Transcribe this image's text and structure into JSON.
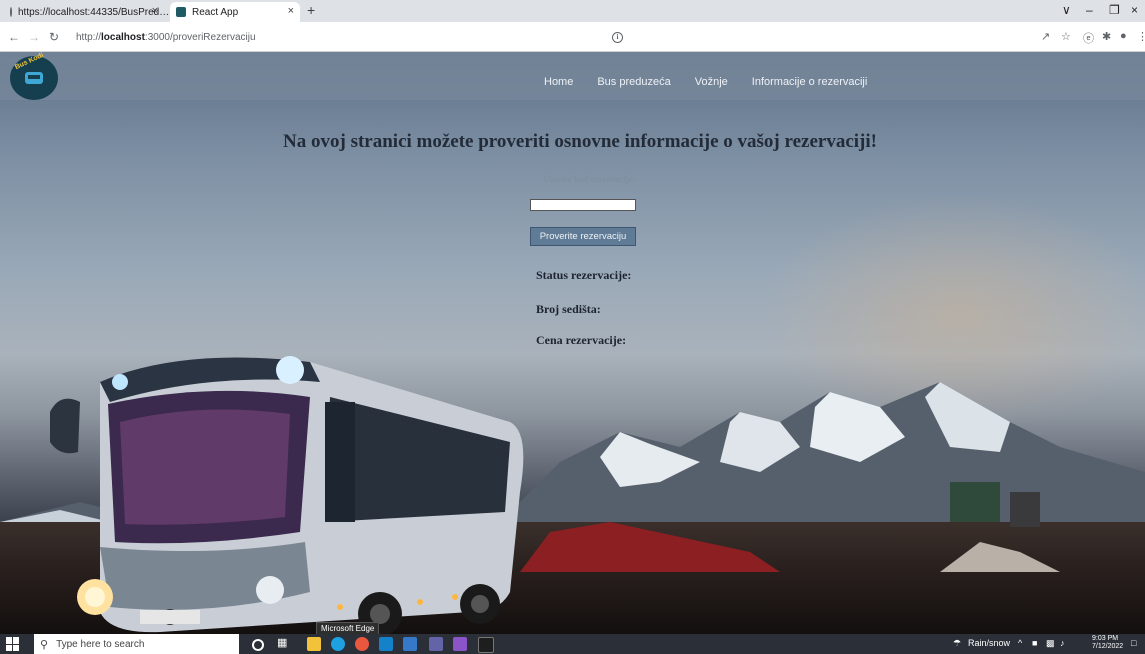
{
  "browser": {
    "tabs": [
      {
        "title": "https://localhost:44335/BusPred…",
        "favicon": "globe-icon"
      },
      {
        "title": "React App",
        "favicon": "react-app-icon"
      }
    ],
    "close_glyph": "×",
    "new_tab_glyph": "+",
    "url_scheme": "http://",
    "url_host": "localhost",
    "url_path": ":3000/proveriRezervaciju",
    "window_controls": [
      "∨",
      "–",
      "❐",
      "×"
    ]
  },
  "site": {
    "logo_text": "Bus Kodi",
    "nav": [
      "Home",
      "Bus preduzeća",
      "Vožnje",
      "Informacije o rezervaciji"
    ]
  },
  "page": {
    "heading": "Na ovoj stranici možete proveriti osnovne informacije o vašoj rezervaciji!",
    "code_label": "Unesite kod rezervacije:",
    "code_value": "",
    "check_button": "Proverite rezervaciju",
    "status_label": "Status rezervacije:",
    "seats_label": "Broj sedišta:",
    "price_label": "Cena rezervacije:"
  },
  "taskbar": {
    "search_placeholder": "Type here to search",
    "tooltip": "Microsoft Edge",
    "weather": "Rain/snow",
    "time": "9:03 PM",
    "date": "7/12/2022"
  },
  "colors": {
    "navbar": "#78889b",
    "button": "#5f7b95",
    "heading": "#232b38"
  }
}
